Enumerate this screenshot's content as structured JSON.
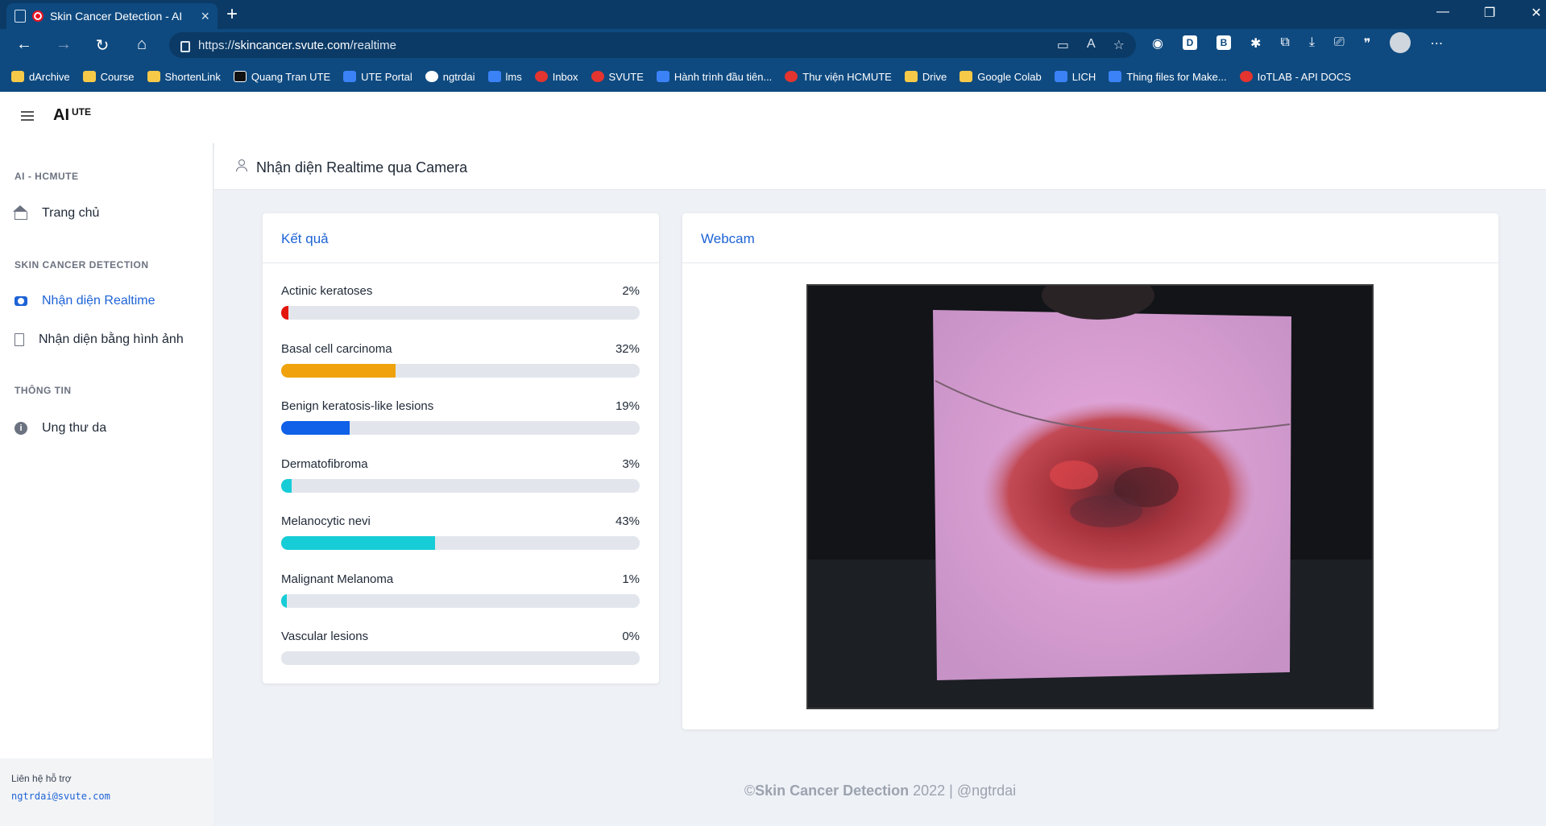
{
  "browser": {
    "tab_title": "Skin Cancer Detection - AI",
    "tab_close": "×",
    "new_tab": "+",
    "url_prefix": "https://",
    "url_host": "skincancer.svute.com",
    "url_path": "/realtime",
    "bookmarks": [
      {
        "label": "dArchive",
        "icon": "folder-icon"
      },
      {
        "label": "Course",
        "icon": "folder-icon"
      },
      {
        "label": "ShortenLink",
        "icon": "shortenlink-icon"
      },
      {
        "label": "Quang Tran UTE",
        "icon": "notion-icon"
      },
      {
        "label": "UTE Portal",
        "icon": "portal-icon"
      },
      {
        "label": "ngtrdai",
        "icon": "github-icon"
      },
      {
        "label": "lms",
        "icon": "lms-icon"
      },
      {
        "label": "Inbox",
        "icon": "gmail-icon"
      },
      {
        "label": "SVUTE",
        "icon": "svute-icon"
      },
      {
        "label": "Hành trình đầu tiên...",
        "icon": "bookmark-icon"
      },
      {
        "label": "Thư viện HCMUTE",
        "icon": "library-icon"
      },
      {
        "label": "Drive",
        "icon": "drive-icon"
      },
      {
        "label": "Google Colab",
        "icon": "colab-icon"
      },
      {
        "label": "LICH",
        "icon": "calendar-icon"
      },
      {
        "label": "Thing files for Make...",
        "icon": "thingiverse-icon"
      },
      {
        "label": "IoTLAB - API DOCS",
        "icon": "iotlab-icon"
      }
    ]
  },
  "app": {
    "brand": "AI",
    "brand_sup": "UTE"
  },
  "sidebar": {
    "section1": "AI - HCMUTE",
    "home": "Trang chủ",
    "section2": "SKIN CANCER DETECTION",
    "realtime": "Nhận diện Realtime",
    "image": "Nhận diện bằng hình ảnh",
    "section3": "THÔNG TIN",
    "info": "Ung thư da",
    "support_label": "Liên hệ hỗ trợ",
    "support_email": "ngtrdai@svute.com"
  },
  "page": {
    "title": "Nhận diện Realtime qua Camera",
    "results_title": "Kết quả",
    "webcam_title": "Webcam"
  },
  "results": [
    {
      "label": "Actinic keratoses",
      "percent": "2%",
      "value": 2,
      "color": "#e3160b"
    },
    {
      "label": "Basal cell carcinoma",
      "percent": "32%",
      "value": 32,
      "color": "#f0a20c"
    },
    {
      "label": "Benign keratosis-like lesions",
      "percent": "19%",
      "value": 19,
      "color": "#1060e8"
    },
    {
      "label": "Dermatofibroma",
      "percent": "3%",
      "value": 3,
      "color": "#16ccd6"
    },
    {
      "label": "Melanocytic nevi",
      "percent": "43%",
      "value": 43,
      "color": "#16ccd6"
    },
    {
      "label": "Malignant Melanoma",
      "percent": "1%",
      "value": 1,
      "color": "#16ccd6"
    },
    {
      "label": "Vascular lesions",
      "percent": "0%",
      "value": 0,
      "color": "#16ccd6"
    }
  ],
  "footer": {
    "copyright": "©",
    "name": "Skin Cancer Detection",
    "rest": " 2022 | @ngtrdai"
  }
}
